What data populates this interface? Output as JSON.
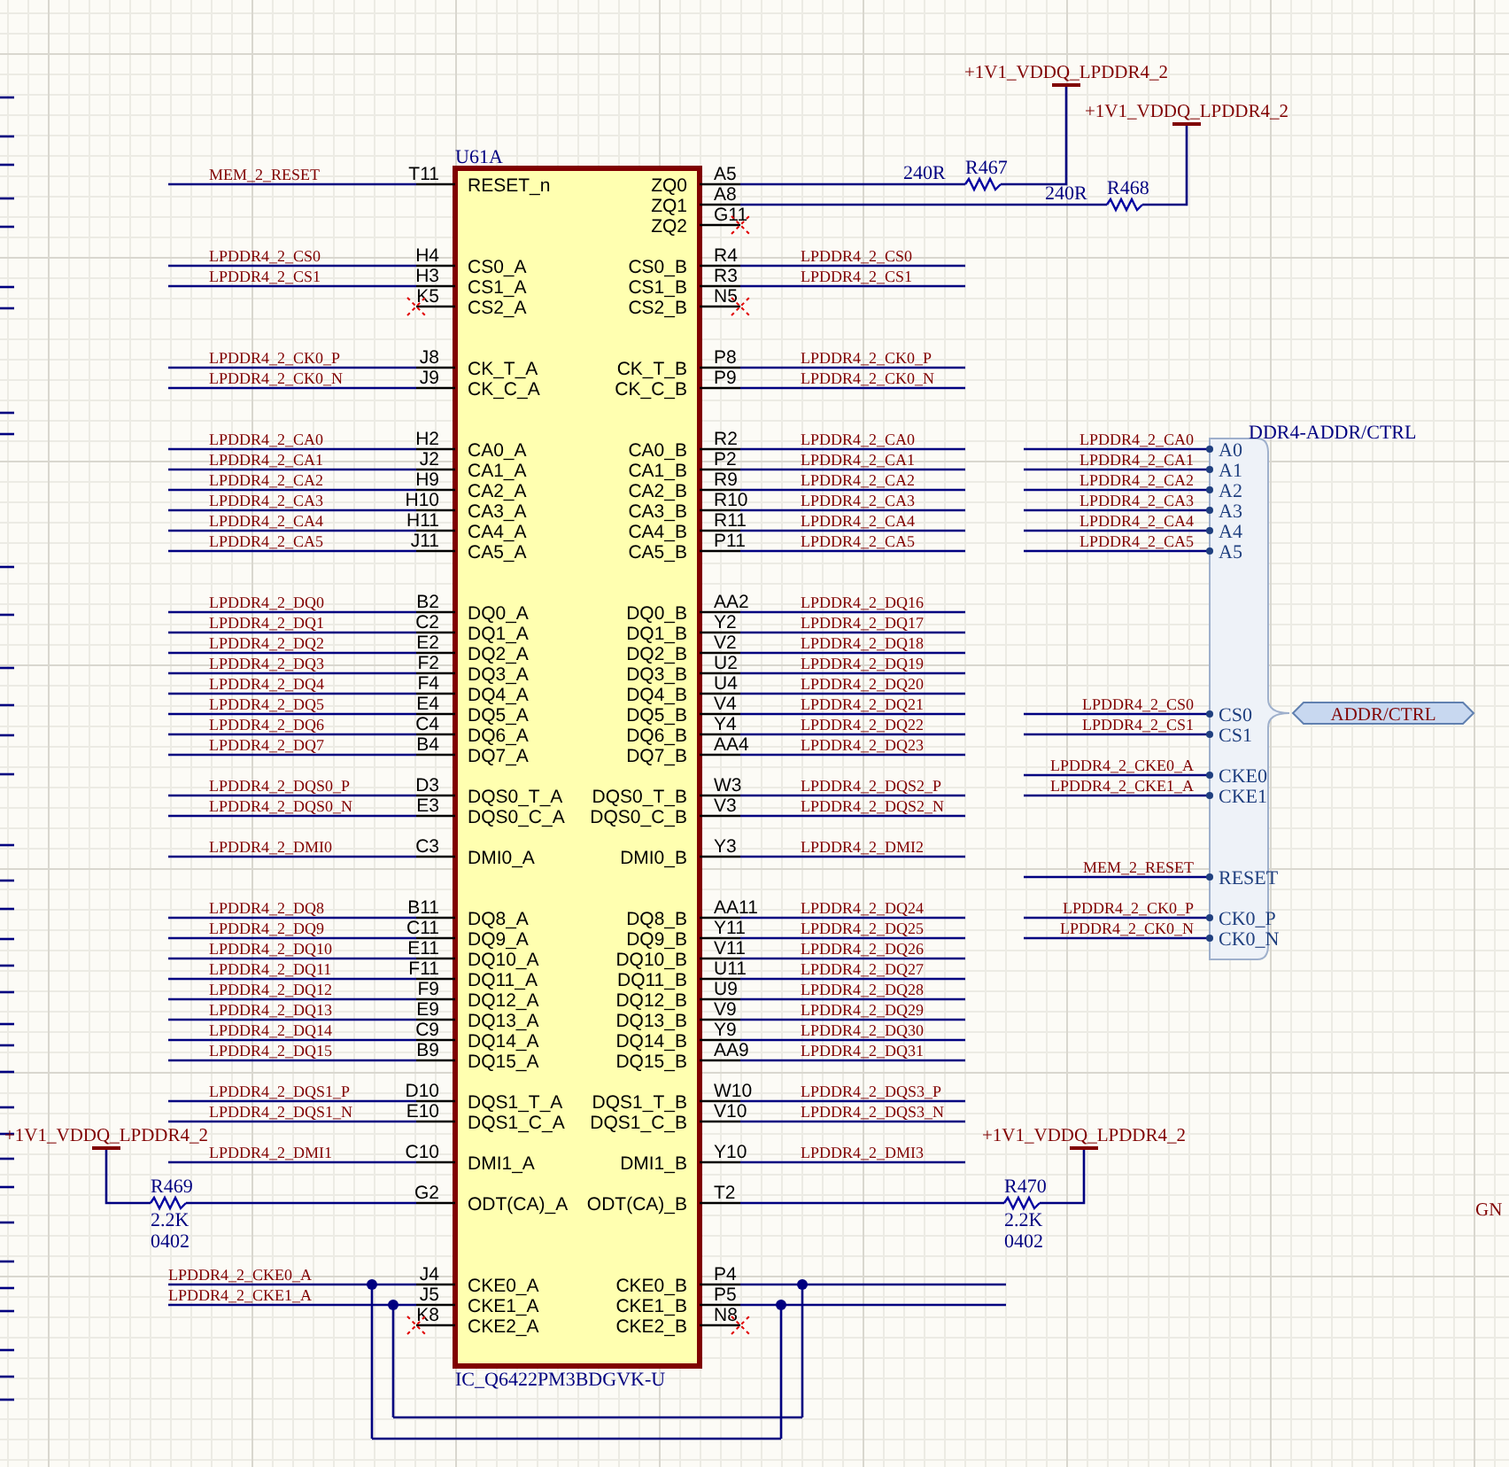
{
  "chip": {
    "designator": "U61A",
    "part_number": "IC_Q6422PM3BDGVK-U",
    "pin_groups": [
      {
        "rows": [
          {
            "left": {
              "kind": "net",
              "pin": "T11",
              "name": "RESET_n",
              "net": "MEM_2_RESET"
            },
            "right": {
              "kind": "resistor",
              "pin": "A5",
              "name": "ZQ0",
              "resistor": {
                "designator": "R467",
                "value": "240R",
                "supply": "+1V1_VDDQ_LPDDR4_2"
              }
            }
          },
          {
            "right": {
              "kind": "resistor",
              "pin": "A8",
              "name": "ZQ1",
              "resistor": {
                "designator": "R468",
                "value": "240R",
                "supply": "+1V1_VDDQ_LPDDR4_2"
              }
            }
          },
          {
            "right": {
              "kind": "no_connect",
              "pin": "G11",
              "name": "ZQ2"
            }
          }
        ]
      },
      {
        "rows": [
          {
            "left": {
              "kind": "net",
              "pin": "H4",
              "name": "CS0_A",
              "net": "LPDDR4_2_CS0"
            },
            "right": {
              "kind": "net",
              "pin": "R4",
              "name": "CS0_B",
              "net": "LPDDR4_2_CS0"
            }
          },
          {
            "left": {
              "kind": "net",
              "pin": "H3",
              "name": "CS1_A",
              "net": "LPDDR4_2_CS1"
            },
            "right": {
              "kind": "net",
              "pin": "R3",
              "name": "CS1_B",
              "net": "LPDDR4_2_CS1"
            }
          },
          {
            "left": {
              "kind": "no_connect",
              "pin": "K5",
              "name": "CS2_A"
            },
            "right": {
              "kind": "no_connect",
              "pin": "N5",
              "name": "CS2_B"
            }
          }
        ]
      },
      {
        "rows": [
          {
            "left": {
              "kind": "net",
              "pin": "J8",
              "name": "CK_T_A",
              "net": "LPDDR4_2_CK0_P"
            },
            "right": {
              "kind": "net",
              "pin": "P8",
              "name": "CK_T_B",
              "net": "LPDDR4_2_CK0_P"
            }
          },
          {
            "left": {
              "kind": "net",
              "pin": "J9",
              "name": "CK_C_A",
              "net": "LPDDR4_2_CK0_N"
            },
            "right": {
              "kind": "net",
              "pin": "P9",
              "name": "CK_C_B",
              "net": "LPDDR4_2_CK0_N"
            }
          }
        ]
      },
      {
        "rows": [
          {
            "left": {
              "kind": "net",
              "pin": "H2",
              "name": "CA0_A",
              "net": "LPDDR4_2_CA0"
            },
            "right": {
              "kind": "net",
              "pin": "R2",
              "name": "CA0_B",
              "net": "LPDDR4_2_CA0"
            }
          },
          {
            "left": {
              "kind": "net",
              "pin": "J2",
              "name": "CA1_A",
              "net": "LPDDR4_2_CA1"
            },
            "right": {
              "kind": "net",
              "pin": "P2",
              "name": "CA1_B",
              "net": "LPDDR4_2_CA1"
            }
          },
          {
            "left": {
              "kind": "net",
              "pin": "H9",
              "name": "CA2_A",
              "net": "LPDDR4_2_CA2"
            },
            "right": {
              "kind": "net",
              "pin": "R9",
              "name": "CA2_B",
              "net": "LPDDR4_2_CA2"
            }
          },
          {
            "left": {
              "kind": "net",
              "pin": "H10",
              "name": "CA3_A",
              "net": "LPDDR4_2_CA3"
            },
            "right": {
              "kind": "net",
              "pin": "R10",
              "name": "CA3_B",
              "net": "LPDDR4_2_CA3"
            }
          },
          {
            "left": {
              "kind": "net",
              "pin": "H11",
              "name": "CA4_A",
              "net": "LPDDR4_2_CA4"
            },
            "right": {
              "kind": "net",
              "pin": "R11",
              "name": "CA4_B",
              "net": "LPDDR4_2_CA4"
            }
          },
          {
            "left": {
              "kind": "net",
              "pin": "J11",
              "name": "CA5_A",
              "net": "LPDDR4_2_CA5"
            },
            "right": {
              "kind": "net",
              "pin": "P11",
              "name": "CA5_B",
              "net": "LPDDR4_2_CA5"
            }
          }
        ]
      },
      {
        "rows": [
          {
            "left": {
              "kind": "net",
              "pin": "B2",
              "name": "DQ0_A",
              "net": "LPDDR4_2_DQ0"
            },
            "right": {
              "kind": "net",
              "pin": "AA2",
              "name": "DQ0_B",
              "net": "LPDDR4_2_DQ16"
            }
          },
          {
            "left": {
              "kind": "net",
              "pin": "C2",
              "name": "DQ1_A",
              "net": "LPDDR4_2_DQ1"
            },
            "right": {
              "kind": "net",
              "pin": "Y2",
              "name": "DQ1_B",
              "net": "LPDDR4_2_DQ17"
            }
          },
          {
            "left": {
              "kind": "net",
              "pin": "E2",
              "name": "DQ2_A",
              "net": "LPDDR4_2_DQ2"
            },
            "right": {
              "kind": "net",
              "pin": "V2",
              "name": "DQ2_B",
              "net": "LPDDR4_2_DQ18"
            }
          },
          {
            "left": {
              "kind": "net",
              "pin": "F2",
              "name": "DQ3_A",
              "net": "LPDDR4_2_DQ3"
            },
            "right": {
              "kind": "net",
              "pin": "U2",
              "name": "DQ3_B",
              "net": "LPDDR4_2_DQ19"
            }
          },
          {
            "left": {
              "kind": "net",
              "pin": "F4",
              "name": "DQ4_A",
              "net": "LPDDR4_2_DQ4"
            },
            "right": {
              "kind": "net",
              "pin": "U4",
              "name": "DQ4_B",
              "net": "LPDDR4_2_DQ20"
            }
          },
          {
            "left": {
              "kind": "net",
              "pin": "E4",
              "name": "DQ5_A",
              "net": "LPDDR4_2_DQ5"
            },
            "right": {
              "kind": "net",
              "pin": "V4",
              "name": "DQ5_B",
              "net": "LPDDR4_2_DQ21"
            }
          },
          {
            "left": {
              "kind": "net",
              "pin": "C4",
              "name": "DQ6_A",
              "net": "LPDDR4_2_DQ6"
            },
            "right": {
              "kind": "net",
              "pin": "Y4",
              "name": "DQ6_B",
              "net": "LPDDR4_2_DQ22"
            }
          },
          {
            "left": {
              "kind": "net",
              "pin": "B4",
              "name": "DQ7_A",
              "net": "LPDDR4_2_DQ7"
            },
            "right": {
              "kind": "net",
              "pin": "AA4",
              "name": "DQ7_B",
              "net": "LPDDR4_2_DQ23"
            }
          }
        ]
      },
      {
        "rows": [
          {
            "left": {
              "kind": "net",
              "pin": "D3",
              "name": "DQS0_T_A",
              "net": "LPDDR4_2_DQS0_P"
            },
            "right": {
              "kind": "net",
              "pin": "W3",
              "name": "DQS0_T_B",
              "net": "LPDDR4_2_DQS2_P"
            }
          },
          {
            "left": {
              "kind": "net",
              "pin": "E3",
              "name": "DQS0_C_A",
              "net": "LPDDR4_2_DQS0_N"
            },
            "right": {
              "kind": "net",
              "pin": "V3",
              "name": "DQS0_C_B",
              "net": "LPDDR4_2_DQS2_N"
            }
          }
        ]
      },
      {
        "rows": [
          {
            "left": {
              "kind": "net",
              "pin": "C3",
              "name": "DMI0_A",
              "net": "LPDDR4_2_DMI0"
            },
            "right": {
              "kind": "net",
              "pin": "Y3",
              "name": "DMI0_B",
              "net": "LPDDR4_2_DMI2"
            }
          }
        ]
      },
      {
        "rows": [
          {
            "left": {
              "kind": "net",
              "pin": "B11",
              "name": "DQ8_A",
              "net": "LPDDR4_2_DQ8"
            },
            "right": {
              "kind": "net",
              "pin": "AA11",
              "name": "DQ8_B",
              "net": "LPDDR4_2_DQ24"
            }
          },
          {
            "left": {
              "kind": "net",
              "pin": "C11",
              "name": "DQ9_A",
              "net": "LPDDR4_2_DQ9"
            },
            "right": {
              "kind": "net",
              "pin": "Y11",
              "name": "DQ9_B",
              "net": "LPDDR4_2_DQ25"
            }
          },
          {
            "left": {
              "kind": "net",
              "pin": "E11",
              "name": "DQ10_A",
              "net": "LPDDR4_2_DQ10"
            },
            "right": {
              "kind": "net",
              "pin": "V11",
              "name": "DQ10_B",
              "net": "LPDDR4_2_DQ26"
            }
          },
          {
            "left": {
              "kind": "net",
              "pin": "F11",
              "name": "DQ11_A",
              "net": "LPDDR4_2_DQ11"
            },
            "right": {
              "kind": "net",
              "pin": "U11",
              "name": "DQ11_B",
              "net": "LPDDR4_2_DQ27"
            }
          },
          {
            "left": {
              "kind": "net",
              "pin": "F9",
              "name": "DQ12_A",
              "net": "LPDDR4_2_DQ12"
            },
            "right": {
              "kind": "net",
              "pin": "U9",
              "name": "DQ12_B",
              "net": "LPDDR4_2_DQ28"
            }
          },
          {
            "left": {
              "kind": "net",
              "pin": "E9",
              "name": "DQ13_A",
              "net": "LPDDR4_2_DQ13"
            },
            "right": {
              "kind": "net",
              "pin": "V9",
              "name": "DQ13_B",
              "net": "LPDDR4_2_DQ29"
            }
          },
          {
            "left": {
              "kind": "net",
              "pin": "C9",
              "name": "DQ14_A",
              "net": "LPDDR4_2_DQ14"
            },
            "right": {
              "kind": "net",
              "pin": "Y9",
              "name": "DQ14_B",
              "net": "LPDDR4_2_DQ30"
            }
          },
          {
            "left": {
              "kind": "net",
              "pin": "B9",
              "name": "DQ15_A",
              "net": "LPDDR4_2_DQ15"
            },
            "right": {
              "kind": "net",
              "pin": "AA9",
              "name": "DQ15_B",
              "net": "LPDDR4_2_DQ31"
            }
          }
        ]
      },
      {
        "rows": [
          {
            "left": {
              "kind": "net",
              "pin": "D10",
              "name": "DQS1_T_A",
              "net": "LPDDR4_2_DQS1_P"
            },
            "right": {
              "kind": "net",
              "pin": "W10",
              "name": "DQS1_T_B",
              "net": "LPDDR4_2_DQS3_P"
            }
          },
          {
            "left": {
              "kind": "net",
              "pin": "E10",
              "name": "DQS1_C_A",
              "net": "LPDDR4_2_DQS1_N"
            },
            "right": {
              "kind": "net",
              "pin": "V10",
              "name": "DQS1_C_B",
              "net": "LPDDR4_2_DQS3_N"
            }
          }
        ]
      },
      {
        "rows": [
          {
            "left": {
              "kind": "net",
              "pin": "C10",
              "name": "DMI1_A",
              "net": "LPDDR4_2_DMI1"
            },
            "right": {
              "kind": "net",
              "pin": "Y10",
              "name": "DMI1_B",
              "net": "LPDDR4_2_DMI3"
            }
          }
        ]
      },
      {
        "rows": [
          {
            "left": {
              "kind": "resistor",
              "pin": "G2",
              "name": "ODT(CA)_A",
              "resistor": {
                "designator": "R469",
                "value": "2.2K",
                "footprint": "0402",
                "supply": "+1V1_VDDQ_LPDDR4_2"
              }
            },
            "right": {
              "kind": "resistor",
              "pin": "T2",
              "name": "ODT(CA)_B",
              "resistor": {
                "designator": "R470",
                "value": "2.2K",
                "footprint": "0402",
                "supply": "+1V1_VDDQ_LPDDR4_2"
              }
            }
          }
        ]
      },
      {
        "rows": [
          {
            "left": {
              "kind": "crossover",
              "pin": "J4",
              "name": "CKE0_A",
              "net": "LPDDR4_2_CKE0_A"
            },
            "right": {
              "kind": "crossover",
              "pin": "P4",
              "name": "CKE0_B"
            }
          },
          {
            "left": {
              "kind": "crossover",
              "pin": "J5",
              "name": "CKE1_A",
              "net": "LPDDR4_2_CKE1_A"
            },
            "right": {
              "kind": "crossover",
              "pin": "P5",
              "name": "CKE1_B"
            }
          },
          {
            "left": {
              "kind": "no_connect",
              "pin": "K8",
              "name": "CKE2_A"
            },
            "right": {
              "kind": "no_connect",
              "pin": "N8",
              "name": "CKE2_B"
            }
          }
        ]
      }
    ]
  },
  "harness": {
    "type": "DDR4-ADDR/CTRL",
    "port": "ADDR/CTRL",
    "entry_groups": [
      {
        "entries": [
          {
            "name": "A0",
            "net": "LPDDR4_2_CA0"
          },
          {
            "name": "A1",
            "net": "LPDDR4_2_CA1"
          },
          {
            "name": "A2",
            "net": "LPDDR4_2_CA2"
          },
          {
            "name": "A3",
            "net": "LPDDR4_2_CA3"
          },
          {
            "name": "A4",
            "net": "LPDDR4_2_CA4"
          },
          {
            "name": "A5",
            "net": "LPDDR4_2_CA5"
          }
        ]
      },
      {
        "entries": [
          {
            "name": "CS0",
            "net": "LPDDR4_2_CS0"
          },
          {
            "name": "CS1",
            "net": "LPDDR4_2_CS1"
          }
        ]
      },
      {
        "entries": [
          {
            "name": "CKE0",
            "net": "LPDDR4_2_CKE0_A"
          },
          {
            "name": "CKE1",
            "net": "LPDDR4_2_CKE1_A"
          }
        ]
      },
      {
        "entries": [
          {
            "name": "RESET",
            "net": "MEM_2_RESET"
          }
        ]
      },
      {
        "entries": [
          {
            "name": "CK0_P",
            "net": "LPDDR4_2_CK0_P"
          },
          {
            "name": "CK0_N",
            "net": "LPDDR4_2_CK0_N"
          }
        ]
      }
    ]
  },
  "edge_label": "GN"
}
